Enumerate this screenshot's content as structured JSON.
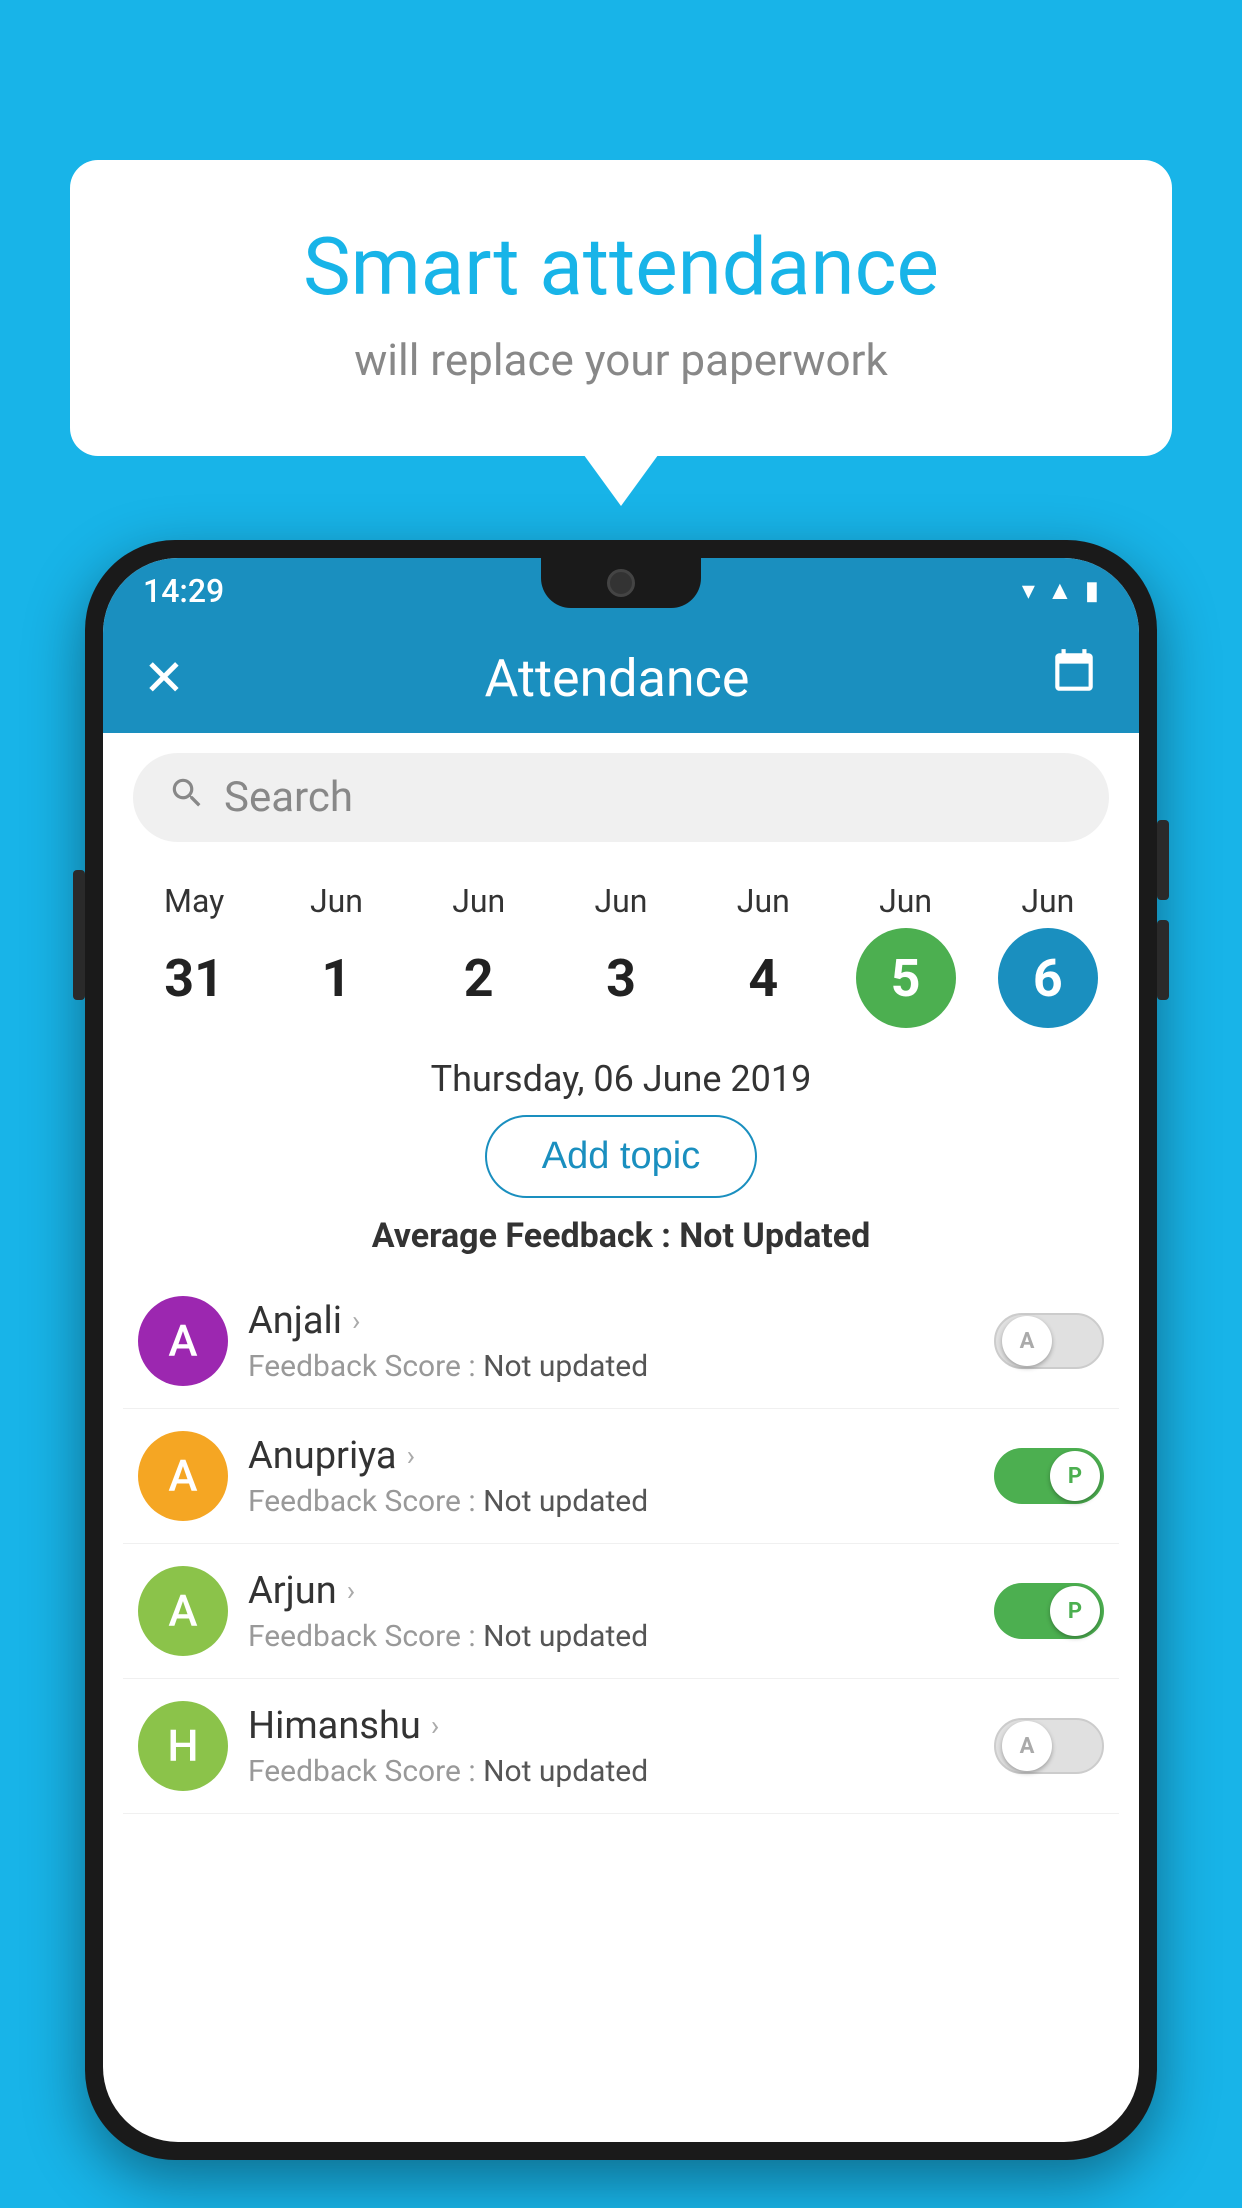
{
  "background_color": "#18b4e8",
  "speech_bubble": {
    "title": "Smart attendance",
    "subtitle": "will replace your paperwork"
  },
  "status_bar": {
    "time": "14:29",
    "icons": [
      "wifi",
      "signal",
      "battery"
    ]
  },
  "app_bar": {
    "title": "Attendance",
    "close_icon": "✕",
    "calendar_icon": "📅"
  },
  "search": {
    "placeholder": "Search"
  },
  "calendar": {
    "days": [
      {
        "month": "May",
        "date": "31",
        "style": "normal"
      },
      {
        "month": "Jun",
        "date": "1",
        "style": "normal"
      },
      {
        "month": "Jun",
        "date": "2",
        "style": "normal"
      },
      {
        "month": "Jun",
        "date": "3",
        "style": "normal"
      },
      {
        "month": "Jun",
        "date": "4",
        "style": "normal"
      },
      {
        "month": "Jun",
        "date": "5",
        "style": "selected-green"
      },
      {
        "month": "Jun",
        "date": "6",
        "style": "selected-blue"
      }
    ],
    "selected_date_label": "Thursday, 06 June 2019"
  },
  "add_topic_label": "Add topic",
  "average_feedback": {
    "label": "Average Feedback : ",
    "value": "Not Updated"
  },
  "students": [
    {
      "name": "Anjali",
      "initial": "A",
      "avatar_color": "#9c27b0",
      "feedback_label": "Feedback Score : ",
      "feedback_value": "Not updated",
      "toggle": "off",
      "toggle_label": "A"
    },
    {
      "name": "Anupriya",
      "initial": "A",
      "avatar_color": "#f5a623",
      "feedback_label": "Feedback Score : ",
      "feedback_value": "Not updated",
      "toggle": "on",
      "toggle_label": "P"
    },
    {
      "name": "Arjun",
      "initial": "A",
      "avatar_color": "#8bc34a",
      "feedback_label": "Feedback Score : ",
      "feedback_value": "Not updated",
      "toggle": "on",
      "toggle_label": "P"
    },
    {
      "name": "Himanshu",
      "initial": "H",
      "avatar_color": "#8bc34a",
      "feedback_label": "Feedback Score : ",
      "feedback_value": "Not updated",
      "toggle": "off",
      "toggle_label": "A"
    }
  ]
}
